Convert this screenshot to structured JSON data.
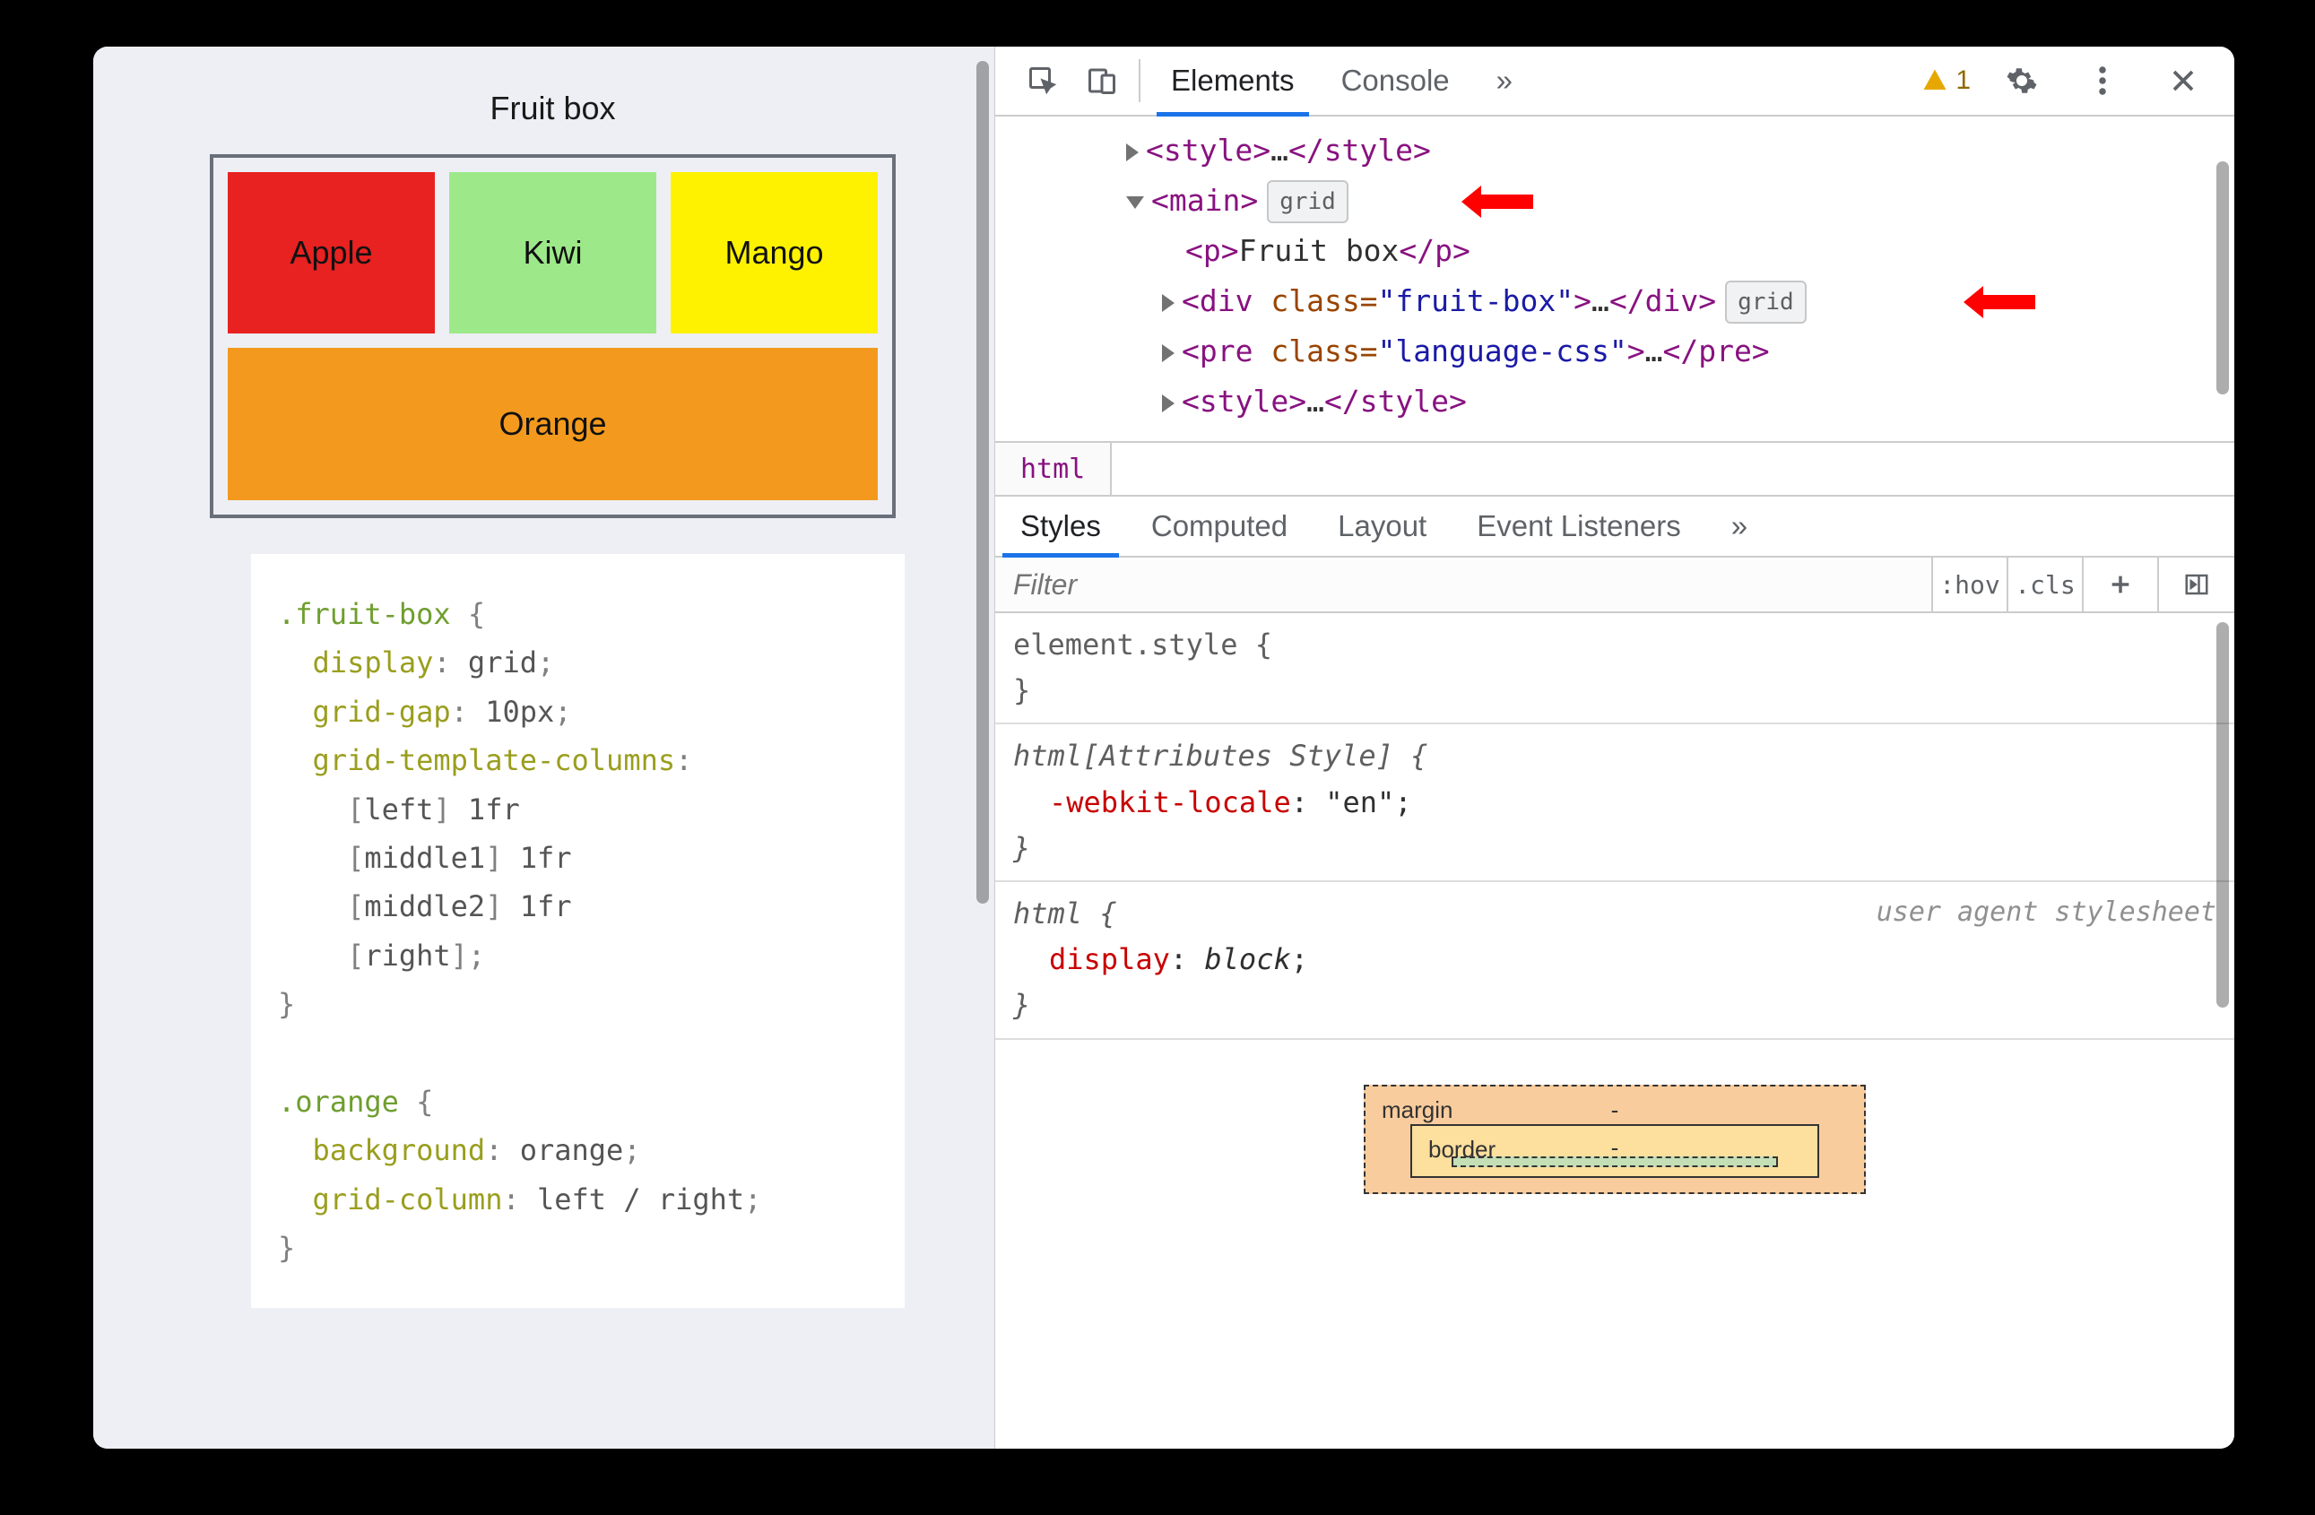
{
  "page": {
    "title": "Fruit box",
    "fruits": {
      "apple": "Apple",
      "kiwi": "Kiwi",
      "mango": "Mango",
      "orange": "Orange"
    },
    "code": ".fruit-box {\n  display: grid;\n  grid-gap: 10px;\n  grid-template-columns:\n    [left] 1fr\n    [middle1] 1fr\n    [middle2] 1fr\n    [right];\n}\n\n.orange {\n  background: orange;\n  grid-column: left / right;\n}"
  },
  "devtools": {
    "tabs": {
      "elements": "Elements",
      "console": "Console",
      "more": "»"
    },
    "warning_count": "1",
    "elements": {
      "style1": {
        "open": "<style>",
        "dots": "…",
        "close": "</style>"
      },
      "main": {
        "open": "<main>",
        "badge": "grid"
      },
      "p": {
        "open": "<p>",
        "text": "Fruit box",
        "close": "</p>"
      },
      "div": {
        "open_pre": "<div ",
        "attr": "class=",
        "val": "\"fruit-box\"",
        "open_post": ">",
        "dots": "…",
        "close": "</div>",
        "badge": "grid"
      },
      "pre": {
        "open_pre": "<pre ",
        "attr": "class=",
        "val": "\"language-css\"",
        "open_post": ">",
        "dots": "…",
        "close": "</pre>"
      },
      "style2": {
        "open": "<style>",
        "dots": "…",
        "close": "</style>"
      }
    },
    "breadcrumb": "html",
    "styles_tabs": {
      "styles": "Styles",
      "computed": "Computed",
      "layout": "Layout",
      "listeners": "Event Listeners",
      "more": "»"
    },
    "filter": {
      "placeholder": "Filter",
      "hov": ":hov",
      "cls": ".cls"
    },
    "rules": {
      "r1": {
        "sel": "element.style {",
        "close": "}"
      },
      "r2": {
        "sel": "html[Attributes Style] {",
        "prop": "-webkit-locale",
        "val": "\"en\"",
        "close": "}"
      },
      "r3": {
        "sel": "html {",
        "source": "user agent stylesheet",
        "prop": "display",
        "val": "block",
        "close": "}"
      }
    },
    "boxmodel": {
      "margin": "margin",
      "margin_top": "-",
      "border": "border",
      "border_top": "-"
    }
  }
}
